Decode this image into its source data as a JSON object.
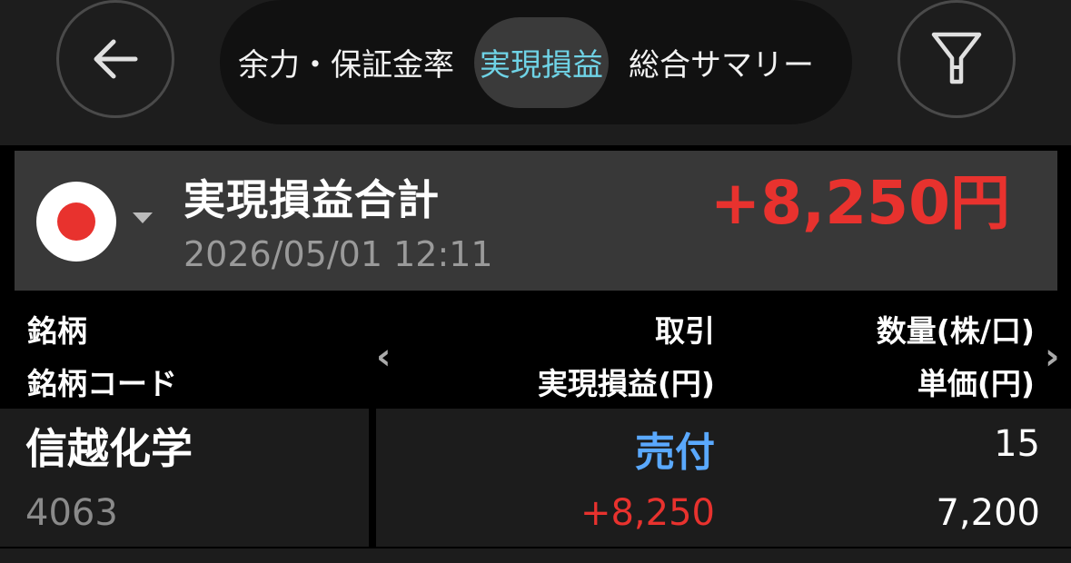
{
  "header": {
    "tabs": [
      {
        "label": "余力・保証金率",
        "active": false
      },
      {
        "label": "実現損益",
        "active": true
      },
      {
        "label": "総合サマリー",
        "active": false
      }
    ]
  },
  "summary": {
    "title": "実現損益合計",
    "timestamp": "2026/05/01 12:11",
    "total": "+8,250円"
  },
  "columns": {
    "left_top": "銘柄",
    "left_bottom": "銘柄コード",
    "mid_top": "取引",
    "mid_bottom": "実現損益(円)",
    "right_top": "数量(株/口)",
    "right_bottom": "単価(円)"
  },
  "rows": [
    {
      "name": "信越化学",
      "code": "4063",
      "trade": "売付",
      "pnl": "+8,250",
      "qty": "15",
      "price": "7,200"
    }
  ],
  "colors": {
    "accent": "#6fd3e6",
    "profit": "#e8322e",
    "sell": "#5aa9ff"
  }
}
